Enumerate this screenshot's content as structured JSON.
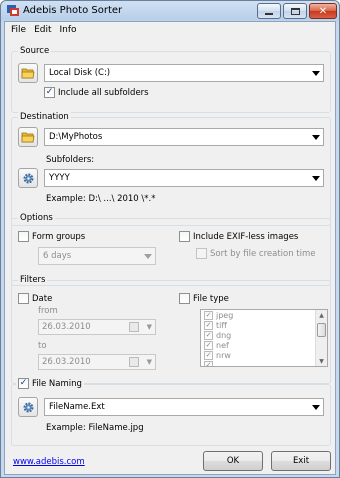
{
  "window": {
    "title": "Adebis Photo Sorter"
  },
  "menu": {
    "file": "File",
    "edit": "Edit",
    "info": "Info"
  },
  "source": {
    "label": "Source",
    "drive": "Local Disk (C:)",
    "include_subfolders": "Include all subfolders"
  },
  "destination": {
    "label": "Destination",
    "path": "D:\\MyPhotos",
    "subfolders_label": "Subfolders:",
    "subfolders_value": "YYYY",
    "example": "Example: D:\\ ...\\ 2010 \\*.*"
  },
  "options": {
    "label": "Options",
    "form_groups": "Form groups",
    "group_days": "6 days",
    "include_exifless": "Include EXIF-less images",
    "sort_by_creation": "Sort by file creation time"
  },
  "filters": {
    "label": "Filters",
    "date": "Date",
    "from_label": "from",
    "from_value": "26.03.2010",
    "to_label": "to",
    "to_value": "26.03.2010",
    "file_type": "File type",
    "types": [
      "jpeg",
      "tiff",
      "dng",
      "nef",
      "nrw",
      "..."
    ]
  },
  "naming": {
    "label": "File Naming",
    "pattern": "FileName.Ext",
    "example": "Example: FileName.jpg"
  },
  "footer": {
    "link": "www.adebis.com",
    "ok": "OK",
    "exit": "Exit"
  },
  "colors": {
    "folder": "#e8b830",
    "link": "#0000ee",
    "close": "#c8391d"
  }
}
